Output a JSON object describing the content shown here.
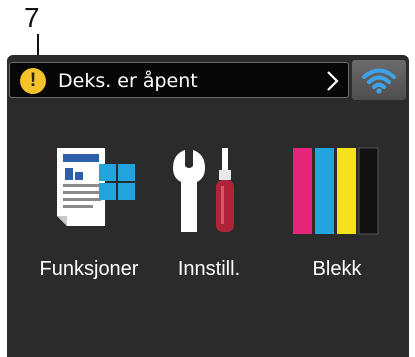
{
  "callout": {
    "number": "7"
  },
  "status_bar": {
    "message": "Deks. er åpent",
    "warning_symbol": "!"
  },
  "apps": [
    {
      "label": "Funksjoner"
    },
    {
      "label": "Innstill."
    },
    {
      "label": "Blekk"
    }
  ],
  "colors": {
    "screen_bg": "#2b2b2b",
    "warning": "#f4c22a",
    "wifi": "#3da3e8",
    "ink_magenta": "#e5257a",
    "ink_cyan": "#22a5df",
    "ink_yellow": "#f5e21a",
    "ink_black": "#111111"
  }
}
